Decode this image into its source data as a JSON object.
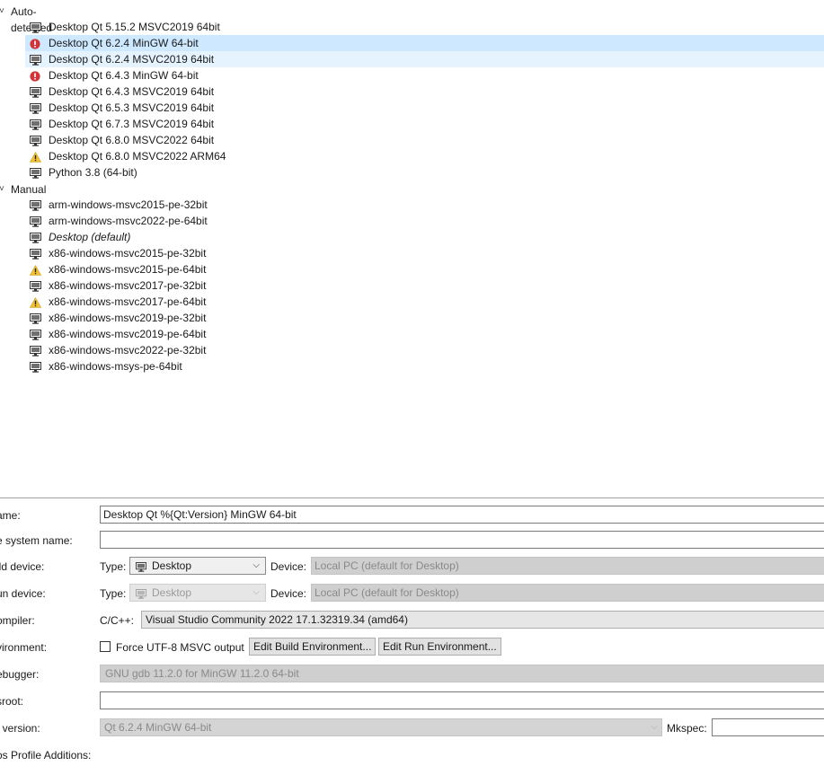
{
  "tree": {
    "groups": [
      {
        "label": "Auto-detected",
        "items": [
          {
            "label": "Desktop Qt 5.15.2 MSVC2019 64bit",
            "icon": "monitor-icon",
            "state": "normal"
          },
          {
            "label": "Desktop Qt 6.2.4 MinGW 64-bit",
            "icon": "error-icon",
            "state": "selected"
          },
          {
            "label": "Desktop Qt 6.2.4 MSVC2019 64bit",
            "icon": "monitor-icon",
            "state": "hover"
          },
          {
            "label": "Desktop Qt 6.4.3 MinGW 64-bit",
            "icon": "error-icon",
            "state": "normal"
          },
          {
            "label": "Desktop Qt 6.4.3 MSVC2019 64bit",
            "icon": "monitor-icon",
            "state": "normal"
          },
          {
            "label": "Desktop Qt 6.5.3 MSVC2019 64bit",
            "icon": "monitor-icon",
            "state": "normal"
          },
          {
            "label": "Desktop Qt 6.7.3 MSVC2019 64bit",
            "icon": "monitor-icon",
            "state": "normal"
          },
          {
            "label": "Desktop Qt 6.8.0 MSVC2022 64bit",
            "icon": "monitor-icon",
            "state": "normal"
          },
          {
            "label": "Desktop Qt 6.8.0 MSVC2022 ARM64",
            "icon": "warning-icon",
            "state": "normal"
          },
          {
            "label": "Python 3.8 (64-bit)",
            "icon": "monitor-icon",
            "state": "normal"
          }
        ]
      },
      {
        "label": "Manual",
        "items": [
          {
            "label": "arm-windows-msvc2015-pe-32bit",
            "icon": "monitor-icon",
            "state": "normal"
          },
          {
            "label": "arm-windows-msvc2022-pe-64bit",
            "icon": "monitor-icon",
            "state": "normal"
          },
          {
            "label": "Desktop (default)",
            "icon": "monitor-icon",
            "state": "normal",
            "italic": true
          },
          {
            "label": "x86-windows-msvc2015-pe-32bit",
            "icon": "monitor-icon",
            "state": "normal"
          },
          {
            "label": "x86-windows-msvc2015-pe-64bit",
            "icon": "warning-icon",
            "state": "normal"
          },
          {
            "label": "x86-windows-msvc2017-pe-32bit",
            "icon": "monitor-icon",
            "state": "normal"
          },
          {
            "label": "x86-windows-msvc2017-pe-64bit",
            "icon": "warning-icon",
            "state": "normal"
          },
          {
            "label": "x86-windows-msvc2019-pe-32bit",
            "icon": "monitor-icon",
            "state": "normal"
          },
          {
            "label": "x86-windows-msvc2019-pe-64bit",
            "icon": "monitor-icon",
            "state": "normal"
          },
          {
            "label": "x86-windows-msvc2022-pe-32bit",
            "icon": "monitor-icon",
            "state": "normal"
          },
          {
            "label": "x86-windows-msys-pe-64bit",
            "icon": "monitor-icon",
            "state": "normal"
          }
        ]
      }
    ]
  },
  "form": {
    "name_label": "ame:",
    "name_value": "Desktop Qt %{Qt:Version} MinGW 64-bit",
    "filesystem_label": "e system name:",
    "filesystem_value": "",
    "build_device_label": "ild device:",
    "build_type_label": "Type:",
    "build_type_value": "Desktop",
    "build_device_field_label": "Device:",
    "build_device_value": "Local PC (default for Desktop)",
    "run_device_label": "un device:",
    "run_type_label": "Type:",
    "run_type_value": "Desktop",
    "run_device_field_label": "Device:",
    "run_device_value": "Local PC (default for Desktop)",
    "compiler_label": "ompiler:",
    "compiler_lang_label": "C/C++:",
    "compiler_value": "Visual Studio Community 2022 17.1.32319.34 (amd64)",
    "environment_label": "vironment:",
    "force_utf8_label": "Force UTF-8 MSVC output",
    "edit_build_env_label": "Edit Build Environment...",
    "edit_run_env_label": "Edit Run Environment...",
    "debugger_label": "ebugger:",
    "debugger_value": "GNU gdb 11.2.0 for MinGW 11.2.0 64-bit",
    "sysroot_label": "sroot:",
    "sysroot_value": "",
    "qt_version_label": "t version:",
    "qt_version_value": "Qt 6.2.4 MinGW 64-bit",
    "mkspec_label": "Mkspec:",
    "mkspec_value": "",
    "qbs_label": "os Profile Additions:"
  },
  "colors": {
    "selected_row": "#cde8ff",
    "hover_row": "#e5f3ff",
    "error": "#d13438",
    "warning": "#f2c230"
  }
}
